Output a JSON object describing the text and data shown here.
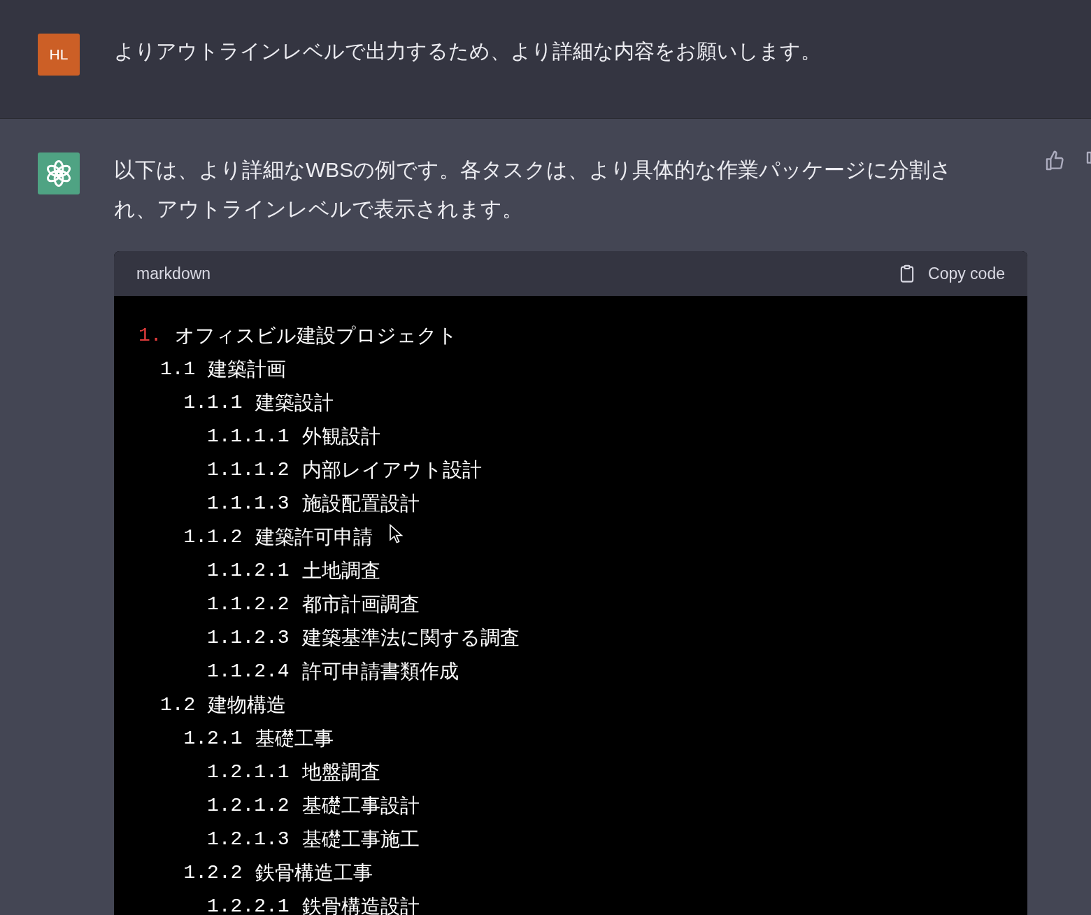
{
  "messages": [
    {
      "kind": "user",
      "avatar": "HL",
      "text": "よりアウトラインレベルで出力するため、より詳細な内容をお願いします。"
    },
    {
      "kind": "assistant",
      "text": "以下は、より詳細なWBSの例です。各タスクは、より具体的な作業パッケージに分割され、アウトラインレベルで表示されます。",
      "code_block": {
        "language": "markdown",
        "copy_label": "Copy code",
        "lines": [
          {
            "number": "1.",
            "text": "オフィスビル建設プロジェクト",
            "children": [
              {
                "number": "1.1",
                "text": "建築計画",
                "children": [
                  {
                    "number": "1.1.1",
                    "text": "建築設計",
                    "children": [
                      {
                        "number": "1.1.1.1",
                        "text": "外観設計"
                      },
                      {
                        "number": "1.1.1.2",
                        "text": "内部レイアウト設計"
                      },
                      {
                        "number": "1.1.1.3",
                        "text": "施設配置設計"
                      }
                    ]
                  },
                  {
                    "number": "1.1.2",
                    "text": "建築許可申請",
                    "children": [
                      {
                        "number": "1.1.2.1",
                        "text": "土地調査"
                      },
                      {
                        "number": "1.1.2.2",
                        "text": "都市計画調査"
                      },
                      {
                        "number": "1.1.2.3",
                        "text": "建築基準法に関する調査"
                      },
                      {
                        "number": "1.1.2.4",
                        "text": "許可申請書類作成"
                      }
                    ]
                  }
                ]
              },
              {
                "number": "1.2",
                "text": "建物構造",
                "children": [
                  {
                    "number": "1.2.1",
                    "text": "基礎工事",
                    "children": [
                      {
                        "number": "1.2.1.1",
                        "text": "地盤調査"
                      },
                      {
                        "number": "1.2.1.2",
                        "text": "基礎工事設計"
                      },
                      {
                        "number": "1.2.1.3",
                        "text": "基礎工事施工"
                      }
                    ]
                  },
                  {
                    "number": "1.2.2",
                    "text": "鉄骨構造工事",
                    "children": [
                      {
                        "number": "1.2.2.1",
                        "text": "鉄骨構造設計"
                      }
                    ]
                  }
                ]
              }
            ]
          }
        ]
      }
    }
  ]
}
